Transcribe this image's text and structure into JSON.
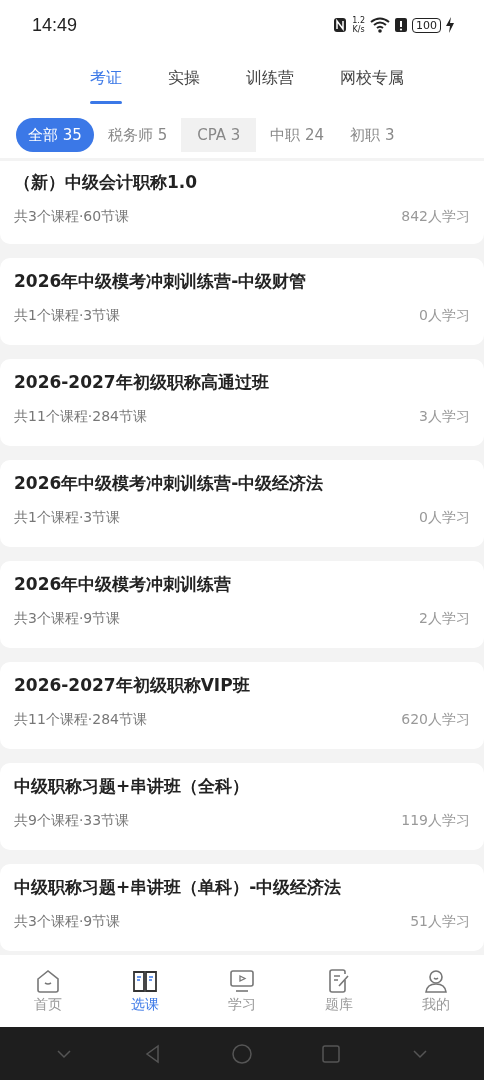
{
  "status_bar": {
    "time": "14:49",
    "speed_value": "1.2",
    "speed_unit": "K/s",
    "battery": "100"
  },
  "tabs": [
    {
      "label": "考证",
      "selected": true
    },
    {
      "label": "实操",
      "selected": false
    },
    {
      "label": "训练营",
      "selected": false
    },
    {
      "label": "网校专属",
      "selected": false
    }
  ],
  "filters": [
    {
      "label": "全部 35",
      "selected": true,
      "pressed": false
    },
    {
      "label": "税务师 5",
      "selected": false,
      "pressed": false
    },
    {
      "label": "CPA 3",
      "selected": false,
      "pressed": true
    },
    {
      "label": "中职 24",
      "selected": false,
      "pressed": false
    },
    {
      "label": "初职 3",
      "selected": false,
      "pressed": false
    }
  ],
  "courses": [
    {
      "title": "（新）中级会计职称1.0",
      "meta": "共3个课程·60节课",
      "learners": "842人学习"
    },
    {
      "title": "2026年中级模考冲刺训练营-中级财管",
      "meta": "共1个课程·3节课",
      "learners": "0人学习"
    },
    {
      "title": "2026-2027年初级职称高通过班",
      "meta": "共11个课程·284节课",
      "learners": "3人学习"
    },
    {
      "title": "2026年中级模考冲刺训练营-中级经济法",
      "meta": "共1个课程·3节课",
      "learners": "0人学习"
    },
    {
      "title": "2026年中级模考冲刺训练营",
      "meta": "共3个课程·9节课",
      "learners": "2人学习"
    },
    {
      "title": "2026-2027年初级职称VIP班",
      "meta": "共11个课程·284节课",
      "learners": "620人学习"
    },
    {
      "title": "中级职称习题+串讲班（全科）",
      "meta": "共9个课程·33节课",
      "learners": "119人学习"
    },
    {
      "title": "中级职称习题+串讲班（单科）-中级经济法",
      "meta": "共3个课程·9节课",
      "learners": "51人学习"
    }
  ],
  "bottom_nav": [
    {
      "label": "首页",
      "kind": "home",
      "selected": false
    },
    {
      "label": "选课",
      "kind": "book",
      "selected": true
    },
    {
      "label": "学习",
      "kind": "video",
      "selected": false
    },
    {
      "label": "题库",
      "kind": "quiz",
      "selected": false
    },
    {
      "label": "我的",
      "kind": "profile",
      "selected": false
    }
  ]
}
